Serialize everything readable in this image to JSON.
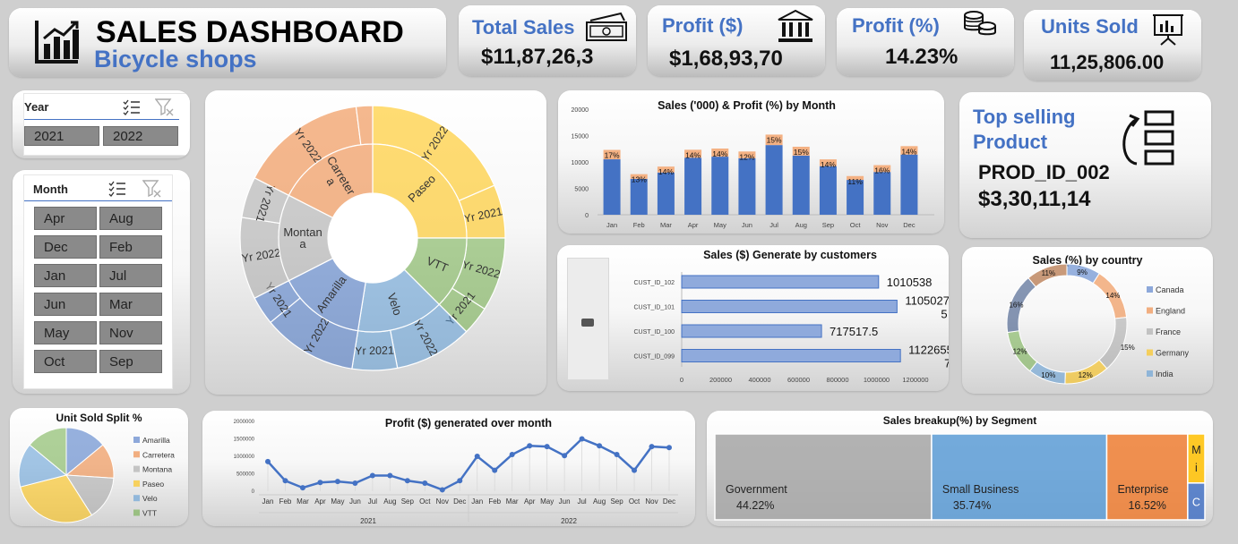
{
  "header": {
    "title": "SALES DASHBOARD",
    "subtitle": "Bicycle shops"
  },
  "kpis": [
    {
      "title": "Total Sales",
      "value": "$11,87,26,3",
      "icon": "money-icon"
    },
    {
      "title": "Profit ($)",
      "value": "$1,68,93,70",
      "icon": "bank-icon"
    },
    {
      "title": "Profit (%)",
      "value": "14.23%",
      "icon": "coins-icon"
    },
    {
      "title": "Units Sold",
      "value": "11,25,806.00",
      "icon": "presentation-chart-icon"
    }
  ],
  "year_slicer": {
    "label": "Year",
    "items": [
      "2021",
      "2022"
    ]
  },
  "month_slicer": {
    "label": "Month",
    "items": [
      "Apr",
      "Aug",
      "Dec",
      "Feb",
      "Jan",
      "Jul",
      "Jun",
      "Mar",
      "May",
      "Nov",
      "Oct",
      "Sep"
    ]
  },
  "top_product": {
    "title_line1": "Top selling",
    "title_line2": "Product",
    "product": "PROD_ID_002",
    "value": "$3,30,11,14"
  },
  "colors": {
    "blue": "#4472c4",
    "orange": "#ed7d31",
    "gray": "#a5a5a5",
    "yellow": "#ffc000",
    "lightblue": "#5b9bd5",
    "green": "#70ad47"
  },
  "chart_data": [
    {
      "type": "sunburst",
      "inner": [
        {
          "name": "Paseo",
          "value": 25,
          "color": "#ffc000"
        },
        {
          "name": "VTT",
          "value": 12.5,
          "color": "#70ad47"
        },
        {
          "name": "Velo",
          "value": 15,
          "color": "#5b9bd5"
        },
        {
          "name": "Amarilla",
          "value": 15,
          "color": "#4472c4"
        },
        {
          "name": "Montana",
          "value": 15,
          "color": "#a5a5a5"
        },
        {
          "name": "Carretera",
          "value": 17.5,
          "color": "#ed7d31"
        }
      ],
      "outer": [
        {
          "name": "Yr 2022",
          "value": 18.5,
          "color": "#ffc000"
        },
        {
          "name": "Yr 2021",
          "value": 6.5,
          "color": "#ffc000"
        },
        {
          "name": "Yr 2022",
          "value": 9,
          "color": "#70ad47"
        },
        {
          "name": "Yr 2021",
          "value": 3.5,
          "color": "#70ad47"
        },
        {
          "name": "Yr 2022",
          "value": 9.5,
          "color": "#5b9bd5"
        },
        {
          "name": "Yr 2021",
          "value": 5.5,
          "color": "#5b9bd5"
        },
        {
          "name": "Yr 2022",
          "value": 11.5,
          "color": "#4472c4"
        },
        {
          "name": "Yr 2021",
          "value": 3.5,
          "color": "#4472c4"
        },
        {
          "name": "Yr 2022",
          "value": 10,
          "color": "#a5a5a5"
        },
        {
          "name": "Yr 2021",
          "value": 5,
          "color": "#a5a5a5"
        },
        {
          "name": "Yr 2022",
          "value": 15.5,
          "color": "#ed7d31"
        },
        {
          "name": "",
          "value": 2,
          "color": "#ed7d31"
        }
      ],
      "inner_labels": [
        "Paseo",
        "VTT",
        "Velo",
        "Amarilla",
        "Montan a",
        "Carreter a"
      ]
    },
    {
      "type": "bar",
      "title": "Sales ('000) & Profit (%) by Month",
      "categories": [
        "Jan",
        "Feb",
        "Mar",
        "Apr",
        "May",
        "Jun",
        "Jul",
        "Aug",
        "Sep",
        "Oct",
        "Nov",
        "Dec"
      ],
      "values": [
        10500,
        6800,
        8000,
        10800,
        11000,
        10700,
        13200,
        11200,
        9200,
        6600,
        8100,
        11400
      ],
      "profit_pct": [
        17,
        13,
        14,
        14,
        14,
        12,
        15,
        15,
        14,
        11,
        16,
        14
      ],
      "profit_labels": [
        "17%",
        "13%",
        "14%",
        "14%",
        "14%",
        "12%",
        "15%",
        "15%",
        "14%",
        "11%",
        "16%",
        "14%"
      ],
      "yticks": [
        "20000",
        "15000",
        "10000",
        "5000",
        "0"
      ],
      "ylim": [
        0,
        20000
      ]
    },
    {
      "type": "bar-horizontal",
      "title": "Sales ($) Generate by customers",
      "categories": [
        "CUST_ID_102",
        "CUST_ID_101",
        "CUST_ID_100",
        "CUST_ID_099"
      ],
      "values": [
        1010538,
        1105027.5,
        717517.5,
        1122655.79
      ],
      "value_labels": [
        "1010538",
        "1105027.\n5",
        "717517.5",
        "1122655.\n79"
      ],
      "xticks": [
        "0",
        "200000",
        "400000",
        "600000",
        "800000",
        "1000000",
        "1200000"
      ],
      "xlim": [
        0,
        1200000
      ]
    },
    {
      "type": "doughnut",
      "title": "Sales (%) by country",
      "series": [
        {
          "name": "Canada",
          "value": 9,
          "label": "9%",
          "color": "#4472c4"
        },
        {
          "name": "England",
          "value": 14,
          "label": "14%",
          "color": "#ed7d31"
        },
        {
          "name": "France",
          "value": 15,
          "label": "15%",
          "color": "#a5a5a5"
        },
        {
          "name": "Germany",
          "value": 12,
          "label": "12%",
          "color": "#ffc000"
        },
        {
          "name": "India",
          "value": 10,
          "label": "10%",
          "color": "#5b9bd5"
        },
        {
          "name": "",
          "value": 12,
          "label": "12%",
          "color": "#70ad47"
        },
        {
          "name": "",
          "value": 16,
          "label": "16%",
          "color": "#264478"
        },
        {
          "name": "",
          "value": 11,
          "label": "11%",
          "color": "#9e480e"
        }
      ],
      "legend": [
        "Canada",
        "England",
        "France",
        "Germany",
        "India"
      ]
    },
    {
      "type": "pie",
      "title": "Unit Sold Split %",
      "series": [
        {
          "name": "Amarilla",
          "value": 14,
          "color": "#4472c4"
        },
        {
          "name": "Carretera",
          "value": 12,
          "color": "#ed7d31"
        },
        {
          "name": "Montana",
          "value": 15,
          "color": "#a5a5a5"
        },
        {
          "name": "Paseo",
          "value": 30,
          "color": "#ffc000"
        },
        {
          "name": "Velo",
          "value": 15,
          "color": "#5b9bd5"
        },
        {
          "name": "VTT",
          "value": 14,
          "color": "#70ad47"
        }
      ]
    },
    {
      "type": "line",
      "title": "Profit  ($) generated over month",
      "categories": [
        "Jan",
        "Feb",
        "Mar",
        "Apr",
        "May",
        "Jun",
        "Jul",
        "Aug",
        "Sep",
        "Oct",
        "Nov",
        "Dec",
        "Jan",
        "Feb",
        "Mar",
        "Apr",
        "May",
        "Jun",
        "Jul",
        "Aug",
        "Sep",
        "Oct",
        "Nov",
        "Dec"
      ],
      "groups": [
        "2021",
        "2022"
      ],
      "values": [
        850000,
        300000,
        100000,
        250000,
        280000,
        230000,
        450000,
        450000,
        300000,
        230000,
        40000,
        300000,
        1000000,
        600000,
        1050000,
        1300000,
        1280000,
        1020000,
        1500000,
        1300000,
        1050000,
        600000,
        1280000,
        1250000
      ],
      "yticks": [
        "2000000",
        "1500000",
        "1000000",
        "500000",
        "0"
      ],
      "ylim": [
        0,
        2000000
      ]
    },
    {
      "type": "treemap",
      "title": "Sales breakup(%) by Segment",
      "series": [
        {
          "name": "Government",
          "value": 44.22,
          "label": "44.22%",
          "color": "#a5a5a5"
        },
        {
          "name": "Small Business",
          "value": 35.74,
          "label": "35.74%",
          "color": "#5b9bd5"
        },
        {
          "name": "Enterprise",
          "value": 16.52,
          "label": "16.52%",
          "color": "#ed7d31"
        },
        {
          "name": "Mi",
          "value": 2,
          "label": "",
          "color": "#ffc000"
        },
        {
          "name": "C",
          "value": 1.5,
          "label": "",
          "color": "#4472c4"
        }
      ]
    }
  ]
}
